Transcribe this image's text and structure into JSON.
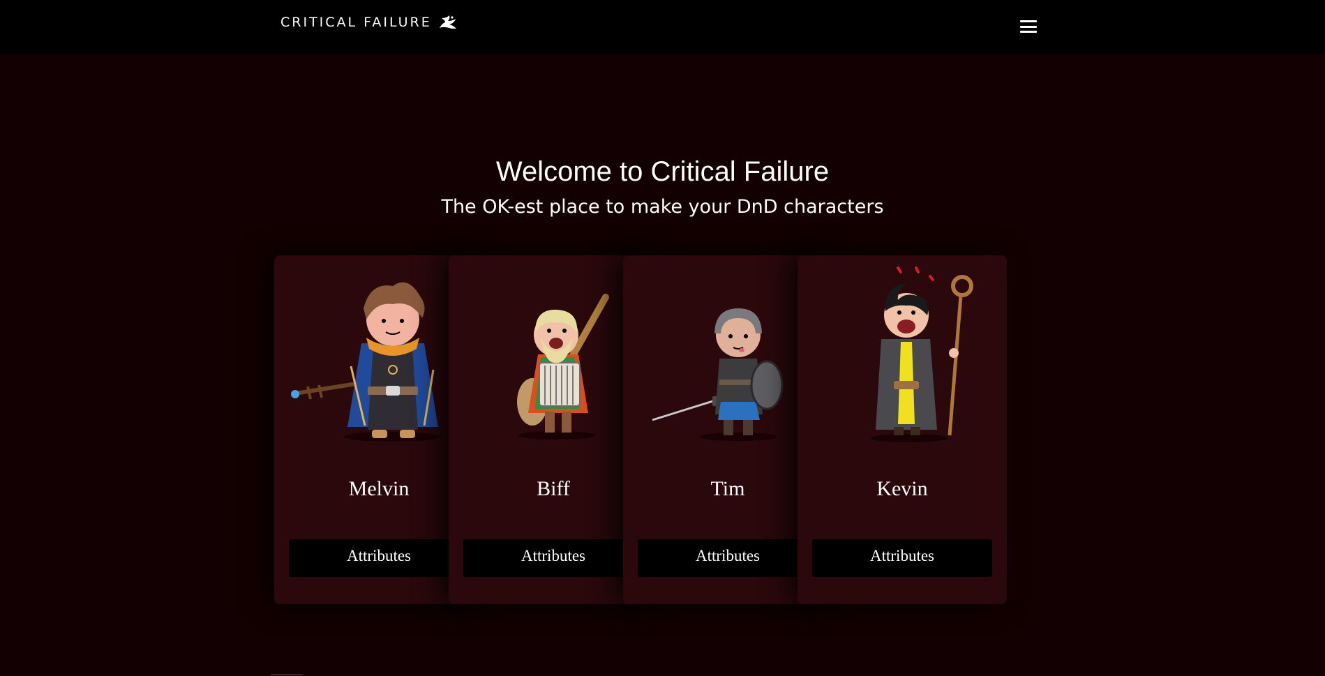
{
  "navbar": {
    "brand_text": "CRITICAL FAILURE",
    "logo_icon": "dragon-logo-icon",
    "menu_icon": "hamburger-menu-icon"
  },
  "hero": {
    "title": "Welcome to Critical Failure",
    "subtitle": "The OK-est place to make your DnD characters"
  },
  "characters": [
    {
      "name": "Melvin",
      "button_label": "Attributes",
      "portrait_icon": "wizard-blue-robe-portrait"
    },
    {
      "name": "Biff",
      "button_label": "Attributes",
      "portrait_icon": "bard-pan-flute-portrait"
    },
    {
      "name": "Tim",
      "button_label": "Attributes",
      "portrait_icon": "fighter-sword-shield-portrait"
    },
    {
      "name": "Kevin",
      "button_label": "Attributes",
      "portrait_icon": "sorcerer-staff-portrait"
    }
  ],
  "colors": {
    "page_background": "#130002",
    "navbar_background": "#000000",
    "card_background": "#2a080c",
    "button_background": "#000000",
    "text": "#ffffff"
  }
}
